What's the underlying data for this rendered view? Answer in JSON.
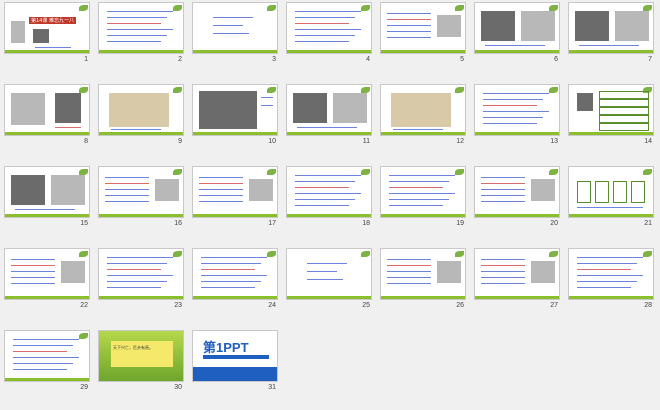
{
  "slides": [
    {
      "n": "1",
      "kind": "title",
      "title": "第14课 难忘九一八"
    },
    {
      "n": "2",
      "kind": "text"
    },
    {
      "n": "3",
      "kind": "text-sparse"
    },
    {
      "n": "4",
      "kind": "text"
    },
    {
      "n": "5",
      "kind": "text-pic"
    },
    {
      "n": "6",
      "kind": "photos"
    },
    {
      "n": "7",
      "kind": "photos"
    },
    {
      "n": "8",
      "kind": "portrait"
    },
    {
      "n": "9",
      "kind": "map"
    },
    {
      "n": "10",
      "kind": "photo-large"
    },
    {
      "n": "11",
      "kind": "photos"
    },
    {
      "n": "12",
      "kind": "map"
    },
    {
      "n": "13",
      "kind": "text"
    },
    {
      "n": "14",
      "kind": "table"
    },
    {
      "n": "15",
      "kind": "photos"
    },
    {
      "n": "16",
      "kind": "text-pic"
    },
    {
      "n": "17",
      "kind": "text-pic"
    },
    {
      "n": "18",
      "kind": "text"
    },
    {
      "n": "19",
      "kind": "text"
    },
    {
      "n": "20",
      "kind": "text-pic"
    },
    {
      "n": "21",
      "kind": "diagram"
    },
    {
      "n": "22",
      "kind": "text-pic"
    },
    {
      "n": "23",
      "kind": "text"
    },
    {
      "n": "24",
      "kind": "text"
    },
    {
      "n": "25",
      "kind": "text-sparse"
    },
    {
      "n": "26",
      "kind": "text-pic"
    },
    {
      "n": "27",
      "kind": "text-pic"
    },
    {
      "n": "28",
      "kind": "text"
    },
    {
      "n": "29",
      "kind": "text"
    },
    {
      "n": "30",
      "kind": "green"
    },
    {
      "n": "31",
      "kind": "ppt"
    }
  ],
  "slide30": {
    "quote": "天下兴亡，匹夫有责。"
  },
  "slide31": {
    "logo": "第1PPT"
  },
  "colors": {
    "accent": "#8cbf2e",
    "text": "#3b5bd1",
    "red": "#d23a3a",
    "brand": "#1f5fbf"
  }
}
